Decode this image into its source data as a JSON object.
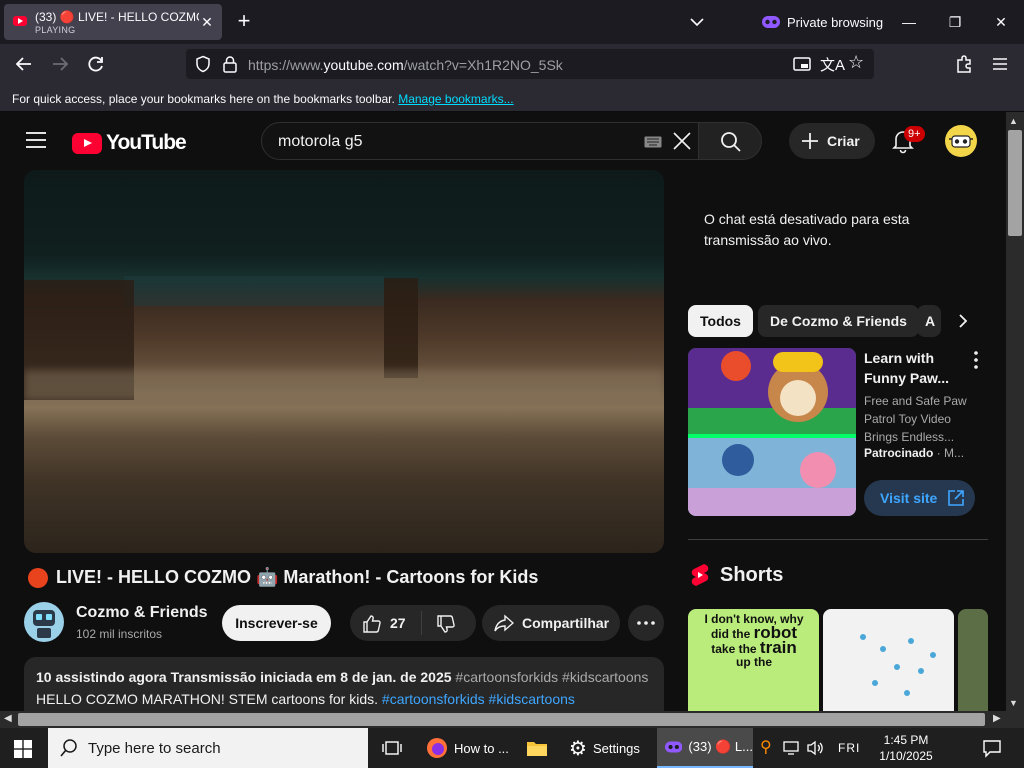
{
  "browser": {
    "tab": {
      "title": "(33) 🔴 LIVE! - HELLO COZMO",
      "subtitle": "PLAYING"
    },
    "private_label": "Private browsing",
    "url_prefix": "https://www.",
    "url_host": "youtube.com",
    "url_path": "/watch?v=Xh1R2NO_5Sk",
    "bookmarks_text": "For quick access, place your bookmarks here on the bookmarks toolbar.",
    "bookmarks_link": "Manage bookmarks..."
  },
  "youtube": {
    "logo_text": "YouTube",
    "search_query": "motorola g5",
    "create_label": "Criar",
    "notification_badge": "9+",
    "video": {
      "title": "LIVE! - HELLO COZMO 🤖 Marathon! - Cartoons for Kids",
      "channel": "Cozmo & Friends",
      "subscribers": "102 mil inscritos",
      "subscribe_label": "Inscrever-se",
      "likes": "27",
      "share_label": "Compartilhar",
      "desc_stats": "10 assistindo agora  Transmissão iniciada em 8 de jan. de 2025",
      "desc_tags": "#cartoonsforkids #kidscartoons",
      "desc_text": "HELLO COZMO MARATHON! STEM cartoons for kids.",
      "desc_text_tags": "#cartoonsforkids #kidscartoons"
    },
    "chat_message": "O chat está desativado para esta transmissão ao vivo.",
    "chips": [
      "Todos",
      "De Cozmo & Friends",
      "A"
    ],
    "ad": {
      "title": "Learn with Funny Paw...",
      "description": "Free and Safe Paw Patrol Toy Video Brings Endless...",
      "sponsored": "Patrocinado",
      "advertiser": "M...",
      "cta": "Visit site"
    },
    "shorts_label": "Shorts",
    "short1_text": [
      "I don't know, why",
      "did the",
      "robot",
      "take the",
      "train",
      "up",
      "the"
    ]
  },
  "taskbar": {
    "search_placeholder": "Type here to search",
    "apps": [
      "How to ...",
      "Settings",
      "(33) 🔴 L..."
    ],
    "weekday": "FRI",
    "time": "1:45 PM",
    "date": "1/10/2025"
  },
  "colors": {
    "yt_red": "#ff0033",
    "bg": "#0f0f0f",
    "link_blue": "#3ea6ff",
    "live_dot": "#e8431c"
  }
}
